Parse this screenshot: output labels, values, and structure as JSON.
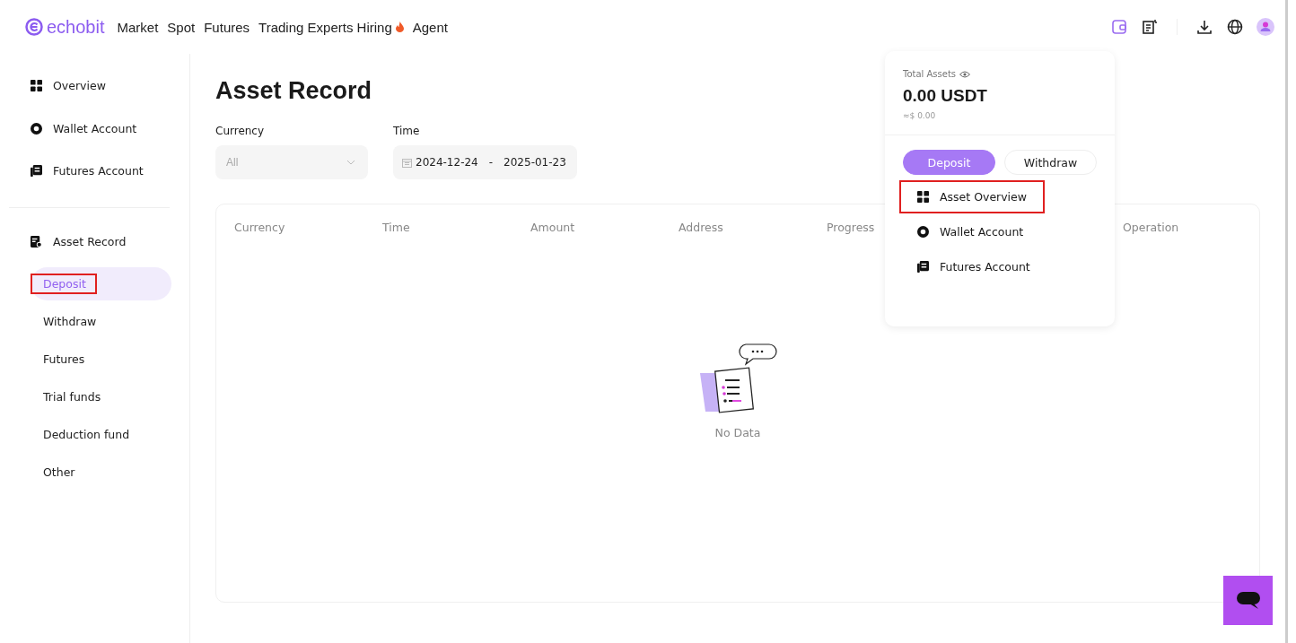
{
  "header": {
    "logo": "echobit",
    "nav": [
      {
        "label": "Market",
        "hot": false
      },
      {
        "label": "Spot",
        "hot": false
      },
      {
        "label": "Futures",
        "hot": false
      },
      {
        "label": "Trading Experts Hiring",
        "hot": true
      },
      {
        "label": "Agent",
        "hot": false
      }
    ]
  },
  "sidebar": {
    "accounts": [
      {
        "label": "Overview"
      },
      {
        "label": "Wallet Account"
      },
      {
        "label": "Futures Account"
      }
    ],
    "record": {
      "label": "Asset Record",
      "items": [
        {
          "label": "Deposit",
          "selected": true,
          "highlighted": true
        },
        {
          "label": "Withdraw",
          "selected": false,
          "highlighted": false
        },
        {
          "label": "Futures",
          "selected": false,
          "highlighted": false
        },
        {
          "label": "Trial funds",
          "selected": false,
          "highlighted": false
        },
        {
          "label": "Deduction fund",
          "selected": false,
          "highlighted": false
        },
        {
          "label": "Other",
          "selected": false,
          "highlighted": false
        }
      ]
    }
  },
  "page": {
    "title": "Asset Record",
    "filters": {
      "currency_label": "Currency",
      "currency_value": "All",
      "time_label": "Time",
      "date_from": "2024-12-24",
      "date_separator": "-",
      "date_to": "2025-01-23"
    },
    "table": {
      "columns": [
        "Currency",
        "Time",
        "Amount",
        "Address",
        "Progress",
        "Operation"
      ],
      "empty_text": "No Data"
    }
  },
  "assets_popup": {
    "label": "Total Assets",
    "amount": "0.00 USDT",
    "fiat": "≈$ 0.00",
    "buttons": [
      {
        "label": "Deposit",
        "primary": true
      },
      {
        "label": "Withdraw",
        "primary": false
      }
    ],
    "menu": [
      {
        "label": "Asset Overview",
        "highlighted": true
      },
      {
        "label": "Wallet Account",
        "highlighted": false
      },
      {
        "label": "Futures Account",
        "highlighted": false
      }
    ]
  }
}
